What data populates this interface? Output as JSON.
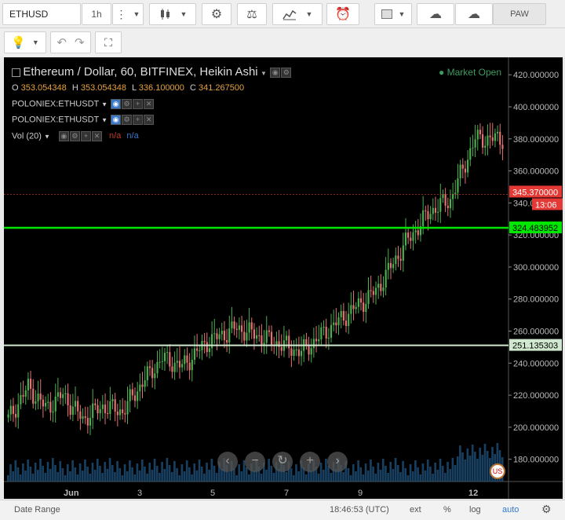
{
  "toolbar": {
    "symbol": "ETHUSD",
    "interval": "1h",
    "user": "PAW",
    "icons": [
      "bar-style-icon",
      "indicators-icon",
      "compare-icon",
      "study-icon",
      "alert-icon",
      "rectangle-icon",
      "cloud-download-icon",
      "cloud-upload-icon"
    ]
  },
  "toolbar2": {
    "icons": [
      "lightbulb-icon",
      "undo-icon",
      "redo-icon",
      "fullscreen-icon"
    ]
  },
  "legend": {
    "title": "Ethereum / Dollar, 60, BITFINEX, Heikin Ashi",
    "o_label": "O",
    "o": "353.054348",
    "h_label": "H",
    "h": "353.054348",
    "l_label": "L",
    "l": "336.100000",
    "c_label": "C",
    "c": "341.267500",
    "ind1": "POLONIEX:ETHUSDT",
    "ind2": "POLONIEX:ETHUSDT",
    "vol": "Vol (20)",
    "na1": "n/a",
    "na2": "n/a",
    "market_status": "Market Open"
  },
  "colors": {
    "up": "#4caf50",
    "down": "#e57373",
    "green_line": "#00e600",
    "white_line": "#cfe8cf",
    "price_tag": "#e53935"
  },
  "price_tags": {
    "last": "345.370000",
    "countdown": "13:06",
    "green_line": "324.483952",
    "white_line": "251.135303"
  },
  "chart_data": {
    "type": "candlestick",
    "y_axis_ticks": [
      "420.000000",
      "400.000000",
      "380.000000",
      "360.000000",
      "340.000000",
      "320.000000",
      "300.000000",
      "280.000000",
      "260.000000",
      "240.000000",
      "220.000000",
      "200.000000",
      "180.000000"
    ],
    "ylim": [
      170,
      425
    ],
    "x_axis_ticks": [
      "Jun",
      "3",
      "5",
      "7",
      "9",
      "12"
    ],
    "anchors_x": [
      0,
      8,
      15,
      22,
      30,
      38,
      46,
      54,
      62,
      70,
      80,
      92,
      104,
      118,
      132,
      148,
      160,
      170,
      178,
      188
    ],
    "anchors_y": [
      205,
      225,
      212,
      220,
      205,
      213,
      210,
      228,
      243,
      238,
      253,
      262,
      255,
      247,
      265,
      285,
      315,
      335,
      342,
      380
    ],
    "count": 200,
    "horizontal_lines": [
      324.483952,
      251.135303,
      345.37
    ]
  },
  "bottom": {
    "date_range": "Date Range",
    "time": "18:46:53 (UTC)",
    "ext": "ext",
    "percent": "%",
    "log": "log",
    "auto": "auto"
  }
}
